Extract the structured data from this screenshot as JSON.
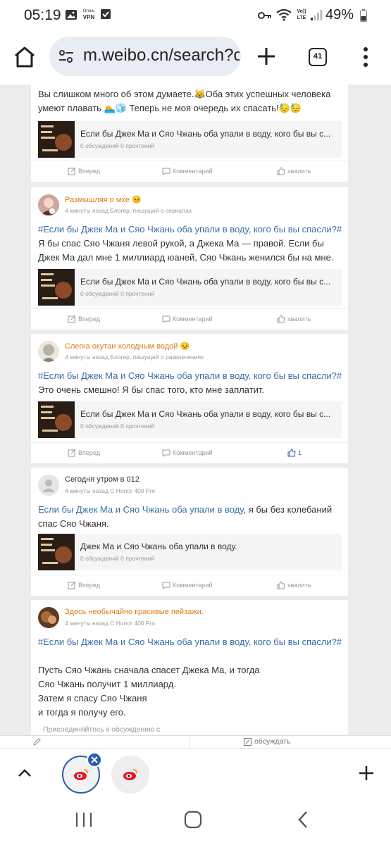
{
  "status_bar": {
    "time": "05:19",
    "vpn_label_top": "Огонь",
    "vpn_label_bottom": "VPN",
    "volte_top": "Vo))",
    "volte_bottom": "LTE",
    "battery": "49%"
  },
  "browser": {
    "url": "m.weibo.cn/search?c",
    "tab_count": "41"
  },
  "posts": [
    {
      "text_line1": "Вы слишком много об этом думаете.",
      "text_line1_b": "Оба этих успешных человека",
      "text_line2": "умеют плавать",
      "text_line2_b": "Теперь не моя очередь их спасать!",
      "link_title": "Если бы Джек Ма и Сяо Чжань оба упали в воду, кого бы вы с...",
      "link_meta": "0 обсуждений 0 прочтений",
      "actions": {
        "repost": "Вперед",
        "comment": "Комментарий",
        "like": "хвалить"
      }
    },
    {
      "username": "Размышляя о мхе",
      "meta": "4 минуты назад Блогер, пишущий о сериалах",
      "topic": "#Если бы Джек Ма и Сяо Чжань оба упали в воду, кого бы вы спасли?#",
      "text_lines": [
        "Я бы спас Сяо Чжаня левой рукой, а Джека Ма — правой. Если бы",
        "Джек Ма дал мне 1 миллиард юаней, Сяо Чжань женился бы на мне."
      ],
      "link_title": "Если бы Джек Ма и Сяо Чжань оба упали в воду, кого бы вы с...",
      "link_meta": "0 обсуждений 0 прочтений",
      "actions": {
        "repost": "Вперед",
        "comment": "Комментарий",
        "like": "хвалить"
      }
    },
    {
      "username": "Слегка окутан холодным водой",
      "meta": "4 минуты назад Блогер, пишущий о развлечениях",
      "topic": "#Если бы Джек Ма и Сяо Чжань оба упали в воду, кого бы вы спасли?#",
      "text": "Это очень смешно! Я бы спас того, кто мне заплатит.",
      "link_title": "Если бы Джек Ма и Сяо Чжань оба упали в воду, кого бы вы с...",
      "link_meta": "0 обсуждений 0 прочтений",
      "actions": {
        "repost": "Вперед",
        "comment": "Комментарий",
        "like": "1"
      }
    },
    {
      "username": "Сегодня утром в 012",
      "meta": "4 минуты назад С Honor 400 Pro",
      "topic_link": "Если бы Джек Ма и Сяо Чжань оба упали в воду",
      "text_after_link": ", я бы без колебаний",
      "text_line2": "спас Сяо Чжаня.",
      "link_title": "Джек Ма и Сяо Чжань оба упали в воду.",
      "link_meta": "0 обсуждений 0 прочтений",
      "actions": {
        "repost": "Вперед",
        "comment": "Комментарий",
        "like": "хвалить"
      }
    },
    {
      "username": "Здесь необычайно красивые пейзажи.",
      "meta": "4 минуты назад С Honor 400 Pro",
      "topic": "#Если бы Джек Ма и Сяо Чжань оба упали в воду, кого бы вы спасли?#",
      "text_lines": [
        "Пусть Сяо Чжань сначала спасет Джека Ма, и тогда",
        "Сяо Чжань получит 1 миллиард.",
        "Затем я спасу Сяо Чжаня",
        "и тогда я получу его."
      ],
      "join_discussion": "Присоединяйтесь к обсуждению с"
    }
  ],
  "reply_bar": {
    "discuss_label": "обсуждать"
  },
  "colors": {
    "username": "#e07b1a",
    "topic": "#3a6ea5",
    "accent": "#2a5ea8"
  },
  "icons": [
    "home-icon",
    "tune-icon",
    "plus-icon",
    "tabs-icon",
    "menu-icon",
    "repost-icon",
    "comment-icon",
    "like-icon",
    "close-icon",
    "chevron-up-icon",
    "weibo-icon",
    "recents-icon",
    "nav-home-icon",
    "back-icon"
  ]
}
